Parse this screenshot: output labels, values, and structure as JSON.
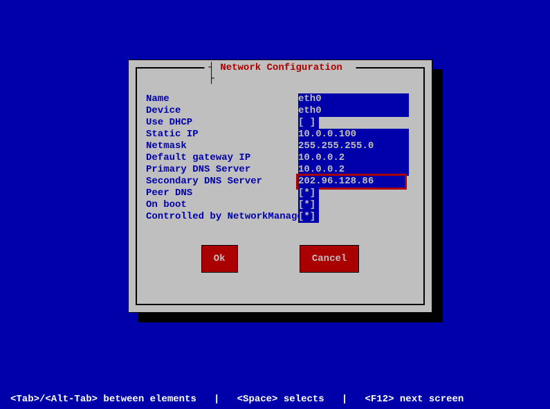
{
  "dialog": {
    "title": "Network Configuration",
    "fields": {
      "name": {
        "label": "Name",
        "value": "eth0"
      },
      "device": {
        "label": "Device",
        "value": "eth0"
      },
      "use_dhcp": {
        "label": "Use DHCP",
        "value": "[ ]"
      },
      "static_ip": {
        "label": "Static IP",
        "value": "10.0.0.100"
      },
      "netmask": {
        "label": "Netmask",
        "value": "255.255.255.0"
      },
      "default_gateway": {
        "label": "Default gateway IP",
        "value": "10.0.0.2"
      },
      "primary_dns": {
        "label": "Primary DNS Server",
        "value": "10.0.0.2"
      },
      "secondary_dns": {
        "label": "Secondary DNS Server",
        "value": "202.96.128.86"
      },
      "peer_dns": {
        "label": "Peer DNS",
        "value": "[*]"
      },
      "on_boot": {
        "label": "On boot",
        "value": "[*]"
      },
      "controlled_nm": {
        "label": "Controlled by NetworkManager",
        "value": "[*]"
      }
    },
    "buttons": {
      "ok": "Ok",
      "cancel": "Cancel"
    }
  },
  "footer": "<Tab>/<Alt-Tab> between elements   |   <Space> selects   |   <F12> next screen"
}
